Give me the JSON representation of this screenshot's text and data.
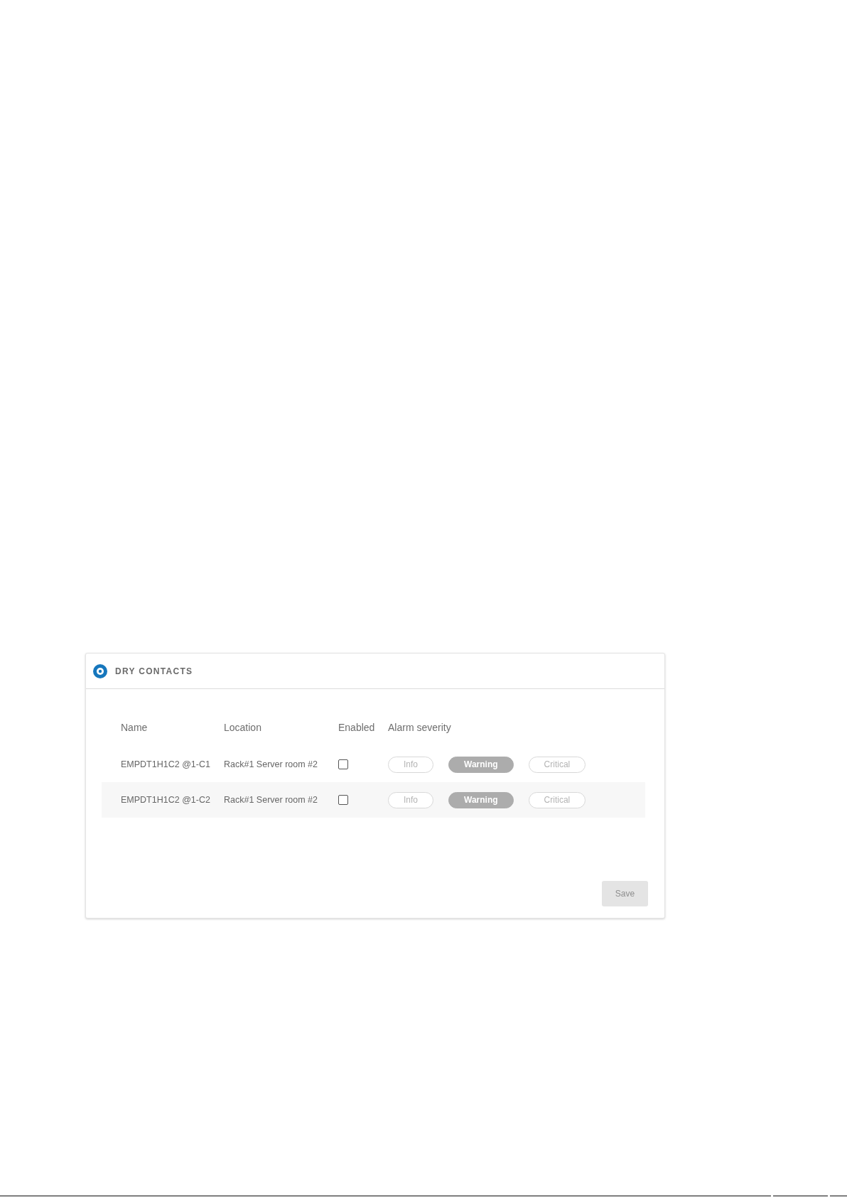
{
  "panel": {
    "title": "DRY CONTACTS"
  },
  "table": {
    "columns": [
      "Name",
      "Location",
      "Enabled",
      "Alarm severity"
    ],
    "rows": [
      {
        "name": "EMPDT1H1C2 @1-C1",
        "location": "Rack#1 Server room #2",
        "enabled": false,
        "severity": [
          {
            "label": "Info",
            "selected": false
          },
          {
            "label": "Warning",
            "selected": true
          },
          {
            "label": "Critical",
            "selected": false
          }
        ]
      },
      {
        "name": "EMPDT1H1C2 @1-C2",
        "location": "Rack#1 Server room #2",
        "enabled": false,
        "severity": [
          {
            "label": "Info",
            "selected": false
          },
          {
            "label": "Warning",
            "selected": true
          },
          {
            "label": "Critical",
            "selected": false
          }
        ]
      }
    ]
  },
  "save_button": {
    "label": "Save",
    "disabled": true
  }
}
